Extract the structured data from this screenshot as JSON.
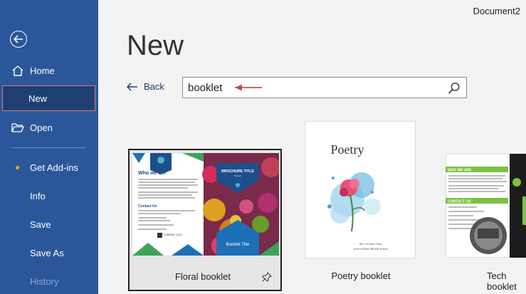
{
  "window": {
    "document_title": "Document2"
  },
  "sidebar": {
    "items": [
      {
        "label": "Home"
      },
      {
        "label": "New"
      },
      {
        "label": "Open"
      },
      {
        "label": "Get Add-ins"
      },
      {
        "label": "Info"
      },
      {
        "label": "Save"
      },
      {
        "label": "Save As"
      },
      {
        "label": "History"
      }
    ]
  },
  "main": {
    "title": "New",
    "back_label": "Back",
    "search": {
      "value": "booklet"
    },
    "templates": [
      {
        "label": "Floral booklet",
        "thumb": {
          "heading": "Who we are",
          "brochure_title": "BROCHURE TITLE",
          "brochure_sub": "Booklet",
          "contact_heading": "Contact Us",
          "logo_text": "COMPANY LOGO",
          "panel_title": "Booklet Title"
        }
      },
      {
        "label": "Poetry booklet",
        "thumb": {
          "heading": "Poetry",
          "class_line": "Mrs. Jordan's Class",
          "school_line": "Jackson Plain Middle School"
        }
      },
      {
        "label": "Tech booklet",
        "thumb": {
          "heading_1": "WHO WE ARE",
          "heading_2": "CONTACT US"
        }
      }
    ]
  },
  "colors": {
    "sidebar": "#2b579a",
    "accent_dot": "#f0a030",
    "arrow": "#c0504d"
  }
}
